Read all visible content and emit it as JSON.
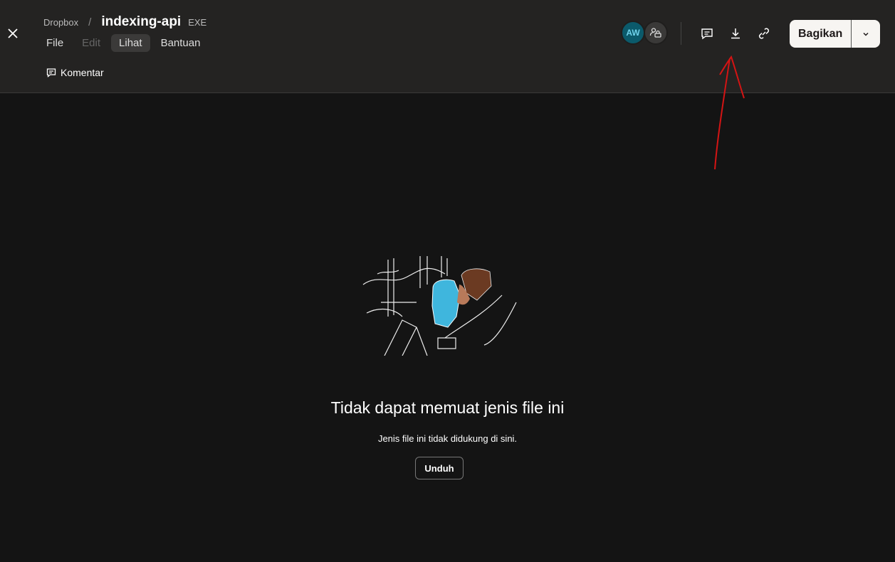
{
  "header": {
    "breadcrumb_root": "Dropbox",
    "separator": "/",
    "file_name": "indexing-api",
    "file_ext": "EXE",
    "menu": [
      {
        "label": "File"
      },
      {
        "label": "Edit"
      },
      {
        "label": "Lihat"
      },
      {
        "label": "Bantuan"
      }
    ],
    "comment_label": "Komentar",
    "avatar_initials": "AW",
    "share_label": "Bagikan"
  },
  "main": {
    "title": "Tidak dapat memuat jenis file ini",
    "subtitle": "Jenis file ini tidak didukung di sini.",
    "download_label": "Unduh"
  },
  "colors": {
    "annotation": "#d41414",
    "avatar_bg": "#0b5a6b"
  }
}
